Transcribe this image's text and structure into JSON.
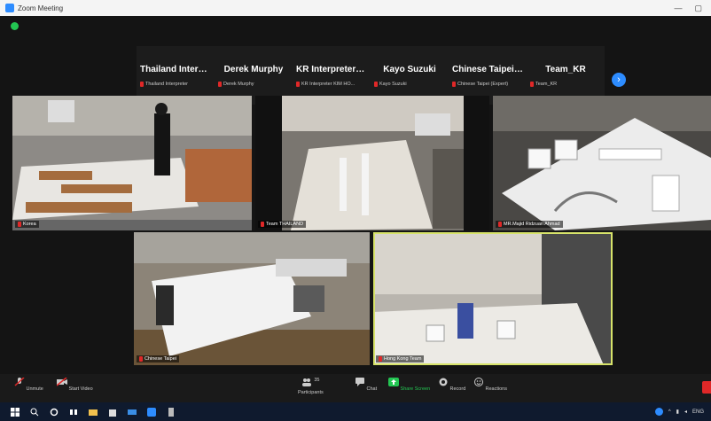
{
  "window": {
    "title": "Zoom Meeting",
    "controls": [
      "—",
      "▢"
    ]
  },
  "participant_strip": [
    {
      "name": "Thailand Interpr...",
      "label": "Thailand Interpreter"
    },
    {
      "name": "Derek Murphy",
      "label": "Derek Murphy"
    },
    {
      "name": "KR Interpreter K...",
      "label": "KR Interpreter KIM HO..."
    },
    {
      "name": "Kayo Suzuki",
      "label": "Kayo Suzuki"
    },
    {
      "name": "Chinese Taipei (...",
      "label": "Chinese Taipei (Expert)"
    },
    {
      "name": "Team_KR",
      "label": "Team_KR"
    }
  ],
  "next_page_glyph": "›",
  "videos": [
    {
      "label": "Korea"
    },
    {
      "label": "Team THAILAND"
    },
    {
      "label": "MR.Majid Ridzuan Ahmad"
    },
    {
      "label": "Chinese Taipei"
    },
    {
      "label": "Hong Kong Team"
    }
  ],
  "toolbar": {
    "unmute": "Unmute",
    "start_video": "Start Video",
    "participants": "Participants",
    "participants_count": "35",
    "chat": "Chat",
    "share_screen": "Share Screen",
    "record": "Record",
    "reactions": "Reactions"
  },
  "tray": {
    "lang": "ENG"
  },
  "colors": {
    "share_green": "#23c552",
    "accent_blue": "#2d8cff",
    "mute_red": "#e02828",
    "active_speaker": "#d7e36a"
  }
}
